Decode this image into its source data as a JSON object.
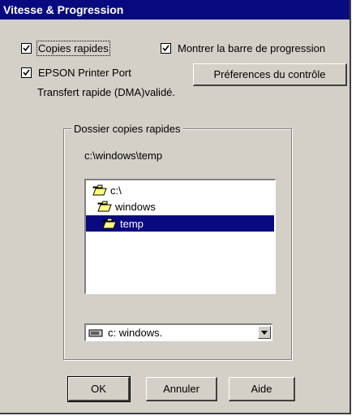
{
  "window": {
    "title": "Vitesse & Progression"
  },
  "options": {
    "fast_copies": {
      "label": "Copies rapides",
      "checked": true
    },
    "show_progress": {
      "label": "Montrer la barre de progression",
      "checked": true
    },
    "epson_port": {
      "label": "EPSON Printer Port",
      "checked": true
    },
    "monitor_prefs_button": "Préferences du contrôle",
    "dma_status": "Transfert rapide (DMA)validé."
  },
  "folder_group": {
    "title": "Dossier copies rapides",
    "current_path": "c:\\windows\\temp",
    "tree": [
      {
        "label": "c:\\",
        "selected": false
      },
      {
        "label": "windows",
        "selected": false
      },
      {
        "label": "temp",
        "selected": true
      }
    ],
    "drive_select": {
      "value": "c:  windows."
    }
  },
  "buttons": {
    "ok": "OK",
    "cancel": "Annuler",
    "help": "Aide"
  },
  "colors": {
    "titlebar": "#0a0a80",
    "face": "#d4d0c8",
    "selection": "#0a0a80"
  }
}
